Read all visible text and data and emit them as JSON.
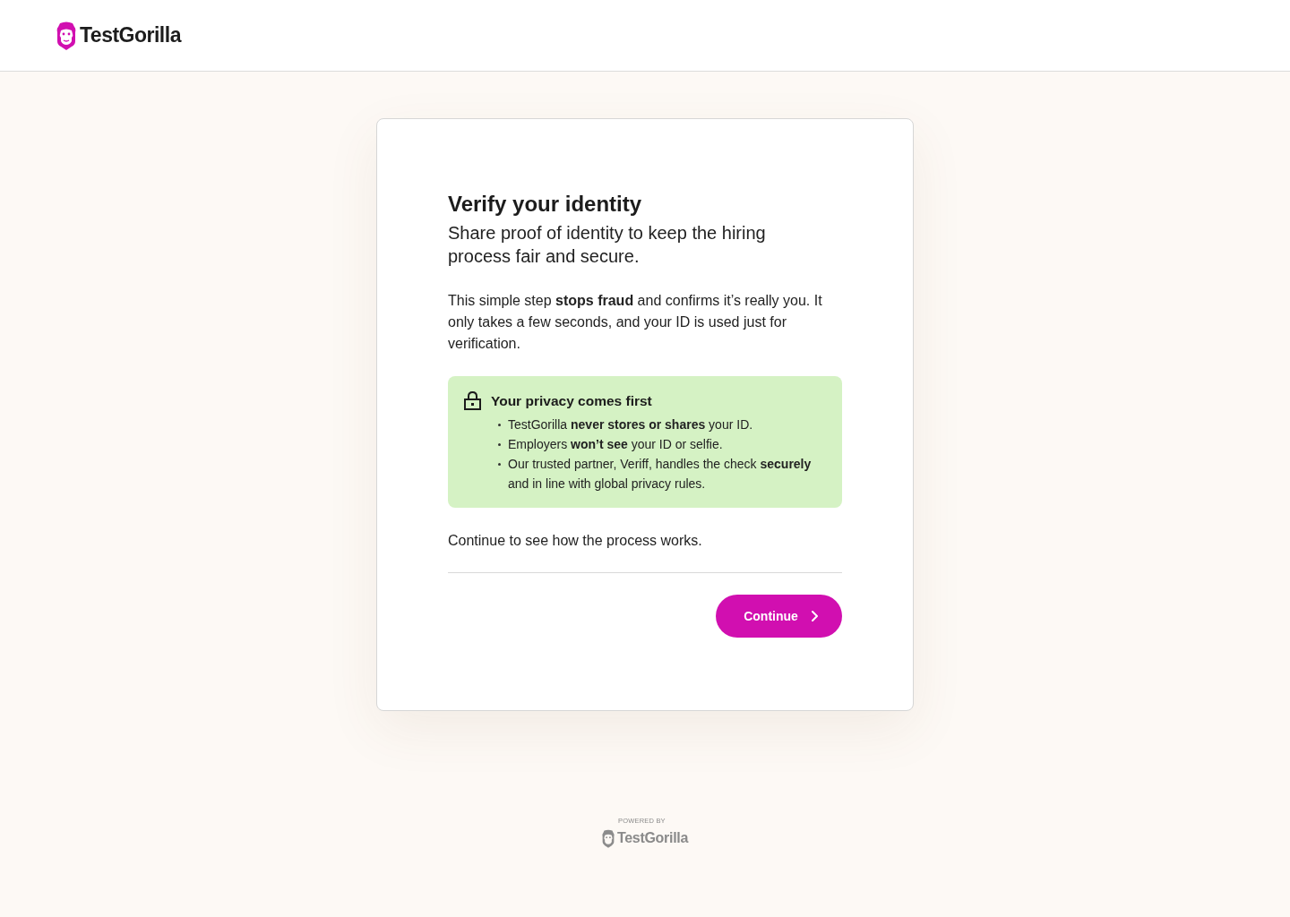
{
  "header": {
    "logo": {
      "text": "TestGorilla"
    }
  },
  "card": {
    "title": "Verify your identity",
    "subtitle": "Share proof of identity to keep the hiring process fair and secure.",
    "body": "This simple step **stops fraud** and confirms it’s really you. It only takes a few seconds, and your ID is used just for verification.",
    "privacy_notice": {
      "heading": "Your privacy comes first",
      "items": [
        "TestGorilla **never stores or shares** your ID.",
        "Employers **won’t see** your ID or selfie.",
        "Our trusted partner, Veriff, handles the check **securely** and in line with global privacy rules."
      ]
    },
    "prompt": "Continue to see how the process works.",
    "primary_button": {
      "label": "Continue"
    }
  },
  "footer": {
    "caption": "POWERED BY",
    "logo": {
      "text": "TestGorilla"
    }
  }
}
